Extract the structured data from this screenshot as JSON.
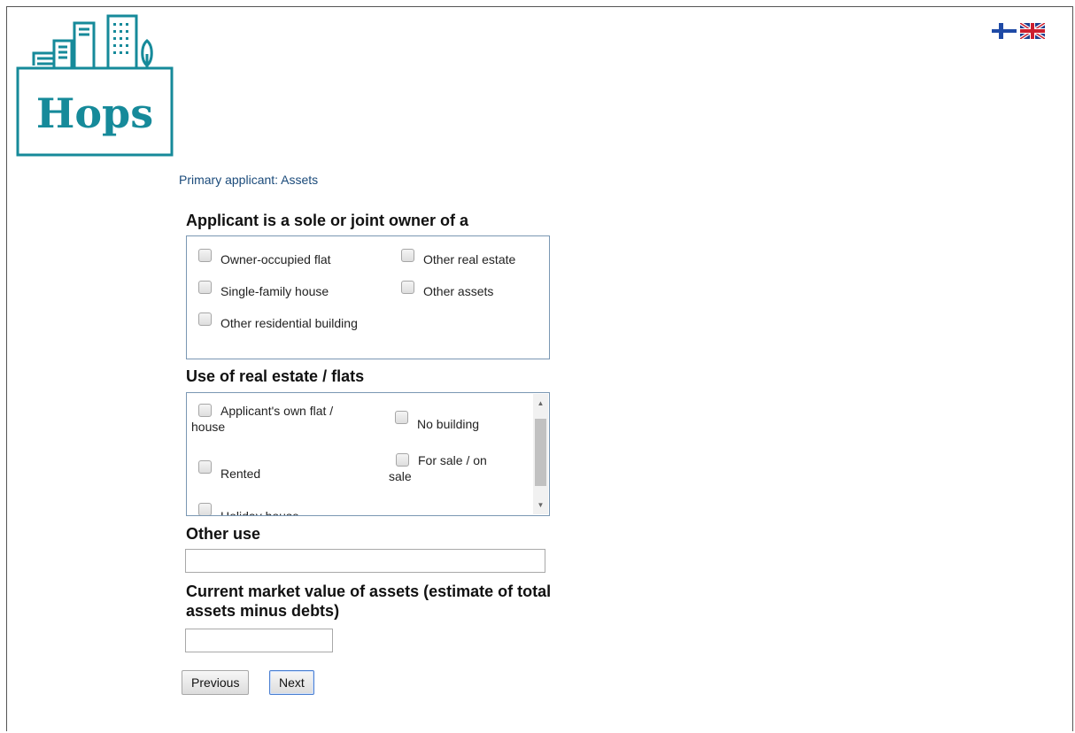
{
  "app": {
    "logo_text": "Hops",
    "brand_color": "#168a9a"
  },
  "language_flags": [
    {
      "icon": "flag-finland-icon"
    },
    {
      "icon": "flag-uk-icon"
    }
  ],
  "breadcrumb": "Primary applicant: Assets",
  "ownership": {
    "heading": "Applicant is a sole or joint owner of a",
    "options": [
      {
        "label": "Owner-occupied flat",
        "checked": false
      },
      {
        "label": "Other real estate",
        "checked": false
      },
      {
        "label": "Single-family house",
        "checked": false
      },
      {
        "label": "Other assets",
        "checked": false
      },
      {
        "label": "Other residential building",
        "checked": false
      }
    ]
  },
  "use": {
    "heading": "Use of real estate / flats",
    "options": [
      {
        "label": "Applicant's own flat / house",
        "checked": false
      },
      {
        "label": "No building",
        "checked": false
      },
      {
        "label": "Rented",
        "checked": false
      },
      {
        "label": "For sale / on sale",
        "checked": false
      },
      {
        "label": "Holiday house",
        "checked": false
      }
    ]
  },
  "other_use": {
    "label": "Other use",
    "value": ""
  },
  "market_value": {
    "label": "Current market value of assets (estimate of total assets minus debts)",
    "value": ""
  },
  "buttons": {
    "previous": "Previous",
    "next": "Next"
  }
}
